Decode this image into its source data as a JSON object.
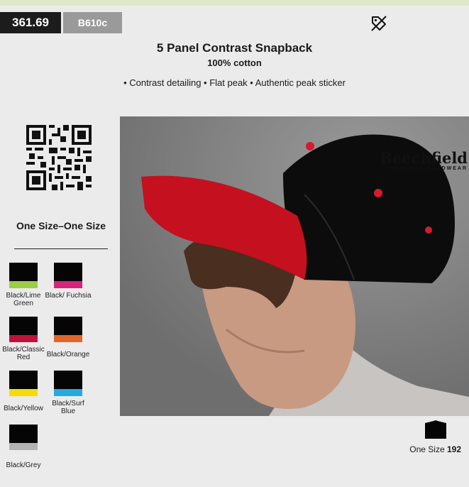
{
  "header": {
    "price": "361.69",
    "sku": "B610c",
    "tag_icon": "no-discount-tag-icon"
  },
  "product": {
    "title": "5 Panel Contrast Snapback",
    "material": "100% cotton",
    "features": "• Contrast detailing • Flat peak • Authentic peak sticker"
  },
  "sizes": {
    "heading": "One Size–One Size",
    "availability_label": "One Size",
    "availability_count": "192"
  },
  "colors": [
    {
      "label": "Black/Lime Green",
      "accent": "#9ccc4a"
    },
    {
      "label": "Black/ Fuchsia",
      "accent": "#d4247e"
    },
    {
      "label": "Black/Classic Red",
      "accent": "#c2123a"
    },
    {
      "label": "Black/Orange",
      "accent": "#e0672a"
    },
    {
      "label": "Black/Yellow",
      "accent": "#f4dc0c"
    },
    {
      "label": "Black/Surf Blue",
      "accent": "#27a9de"
    },
    {
      "label": "Black/Grey",
      "accent": "#b3b3b3"
    }
  ],
  "brand": {
    "name": "Beechfield",
    "sub": "ORIGINAL HEADWEAR"
  }
}
